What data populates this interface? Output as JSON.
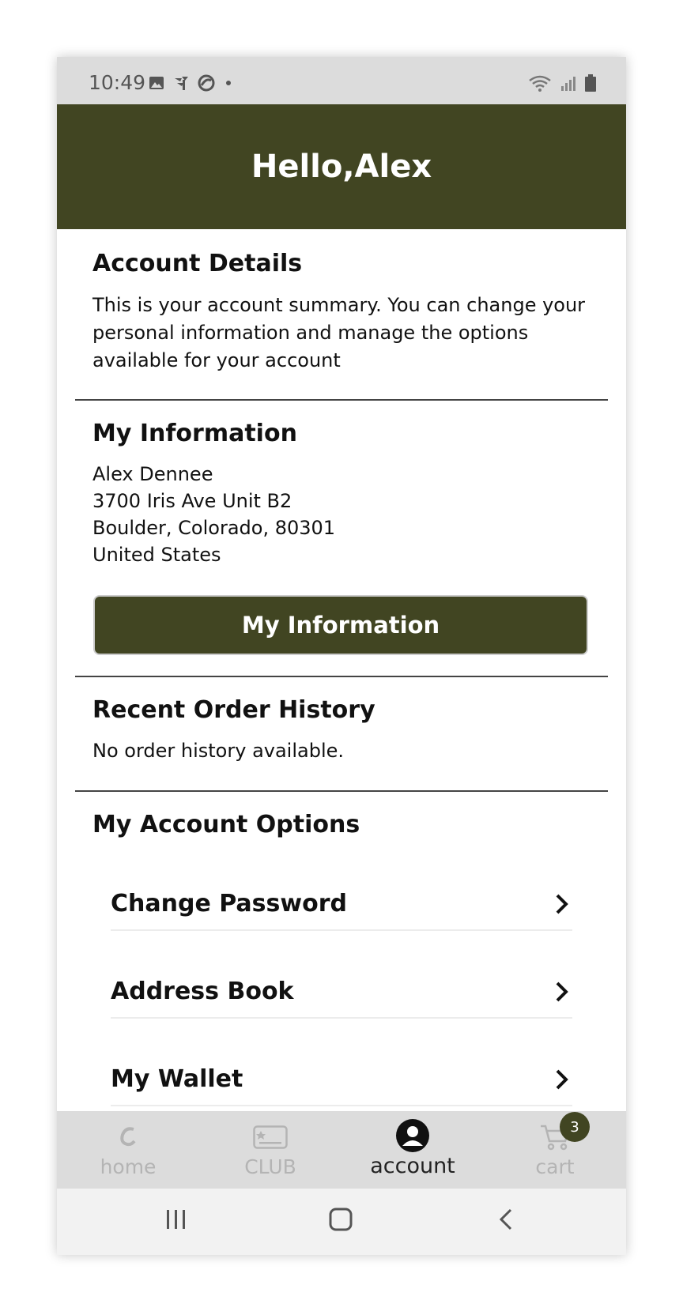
{
  "status_bar": {
    "time": "10:49",
    "left_icons": [
      "image-icon",
      "pinwheel-icon",
      "sync-icon",
      "dot-icon"
    ],
    "right_icons": [
      "wifi-icon",
      "signal-icon",
      "battery-icon"
    ]
  },
  "header": {
    "title": "Hello,Alex"
  },
  "account_details": {
    "title": "Account Details",
    "description": "This is your account summary. You can change your personal information and manage the options available for your account"
  },
  "my_information": {
    "title": "My Information",
    "name": "Alex Dennee",
    "address_line1": "3700 Iris Ave Unit B2",
    "address_line2": "Boulder, Colorado, 80301",
    "country": "United States",
    "button_label": "My Information"
  },
  "order_history": {
    "title": "Recent Order History",
    "empty_text": "No order history available."
  },
  "account_options": {
    "title": "My Account Options",
    "items": [
      {
        "label": "Change Password"
      },
      {
        "label": "Address Book"
      },
      {
        "label": "My Wallet"
      }
    ]
  },
  "tab_bar": {
    "tabs": [
      {
        "label": "home",
        "icon": "brand-c-icon",
        "active": false
      },
      {
        "label": "CLUB",
        "icon": "club-card-icon",
        "active": false
      },
      {
        "label": "account",
        "icon": "account-icon",
        "active": true
      },
      {
        "label": "cart",
        "icon": "cart-icon",
        "active": false
      }
    ],
    "cart_count": "3"
  },
  "colors": {
    "brand": "#414522",
    "header_text": "#ffffff",
    "inactive_tab": "#b4b4b4"
  }
}
